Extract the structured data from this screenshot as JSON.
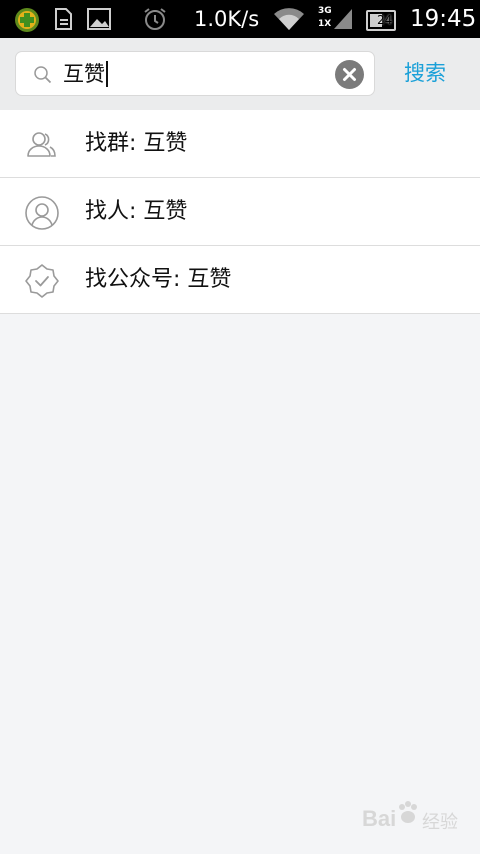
{
  "status_bar": {
    "net_speed": "1.0K/s",
    "network_3g": "3G",
    "network_1x": "1X",
    "battery": "24",
    "time": "19:45"
  },
  "search": {
    "query": "互赞",
    "submit_label": "搜索"
  },
  "results": [
    {
      "label": "找群: 互赞",
      "icon": "group-icon"
    },
    {
      "label": "找人: 互赞",
      "icon": "person-icon"
    },
    {
      "label": "找公众号: 互赞",
      "icon": "badge-icon"
    }
  ],
  "watermark": {
    "brand": "Bai",
    "brand2": "经验"
  },
  "colors": {
    "accent": "#1aa0d8",
    "background": "#f4f5f7",
    "status_bar": "#000000"
  }
}
